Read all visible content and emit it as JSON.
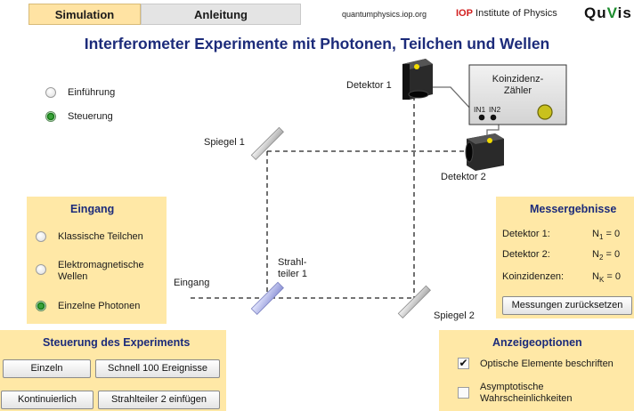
{
  "tabs": [
    {
      "label": "Simulation",
      "active": true
    },
    {
      "label": "Anleitung",
      "active": false
    }
  ],
  "header": {
    "site": "quantumphysics.iop.org",
    "iop_mark": "IOP",
    "iop_name": "Institute of Physics",
    "logo_a": "Qu",
    "logo_b": "V",
    "logo_c": "is"
  },
  "title": "Interferometer Experimente mit Photonen, Teilchen und Wellen",
  "mode": {
    "options": [
      {
        "label": "Einführung",
        "checked": false
      },
      {
        "label": "Steuerung",
        "checked": true
      }
    ]
  },
  "apparatus": {
    "detector1": "Detektor 1",
    "detector2": "Detektor 2",
    "mirror1": "Spiegel 1",
    "mirror2": "Spiegel 2",
    "splitter_line1": "Strahl-",
    "splitter_line2": "teiler 1",
    "input": "Eingang",
    "counter_line1": "Koinzidenz-",
    "counter_line2": "Zähler",
    "in1": "IN1",
    "in2": "IN2"
  },
  "input_panel": {
    "title": "Eingang",
    "options": [
      {
        "label": "Klassische Teilchen",
        "checked": false
      },
      {
        "label_line1": "Elektromagnetische",
        "label_line2": "Wellen",
        "checked": false
      },
      {
        "label": "Einzelne Photonen",
        "checked": true
      }
    ]
  },
  "control_panel": {
    "title": "Steuerung des Experiments",
    "single": "Einzeln",
    "fast100": "Schnell 100 Ereignisse",
    "continuous": "Kontinuierlich",
    "insert_splitter2": "Strahlteiler 2 einfügen"
  },
  "results_panel": {
    "title": "Messergebnisse",
    "rows": [
      {
        "label": "Detektor 1:",
        "sym": "N",
        "sub": "1",
        "value": "= 0"
      },
      {
        "label": "Detektor 2:",
        "sym": "N",
        "sub": "2",
        "value": "= 0"
      },
      {
        "label": "Koinzidenzen:",
        "sym": "N",
        "sub": "K",
        "value": "= 0"
      }
    ],
    "reset": "Messungen zurücksetzen"
  },
  "display_panel": {
    "title": "Anzeigeoptionen",
    "opt1": "Optische Elemente beschriften",
    "opt1_checked": true,
    "opt2_line1": "Asymptotische",
    "opt2_line2": "Wahrscheinlichkeiten",
    "opt2_checked": false
  },
  "colors": {
    "panel_bg": "#ffe8a6",
    "title_blue": "#1c2b7a",
    "iop_red": "#d21f1f",
    "logo_green": "#1d8c2e"
  }
}
